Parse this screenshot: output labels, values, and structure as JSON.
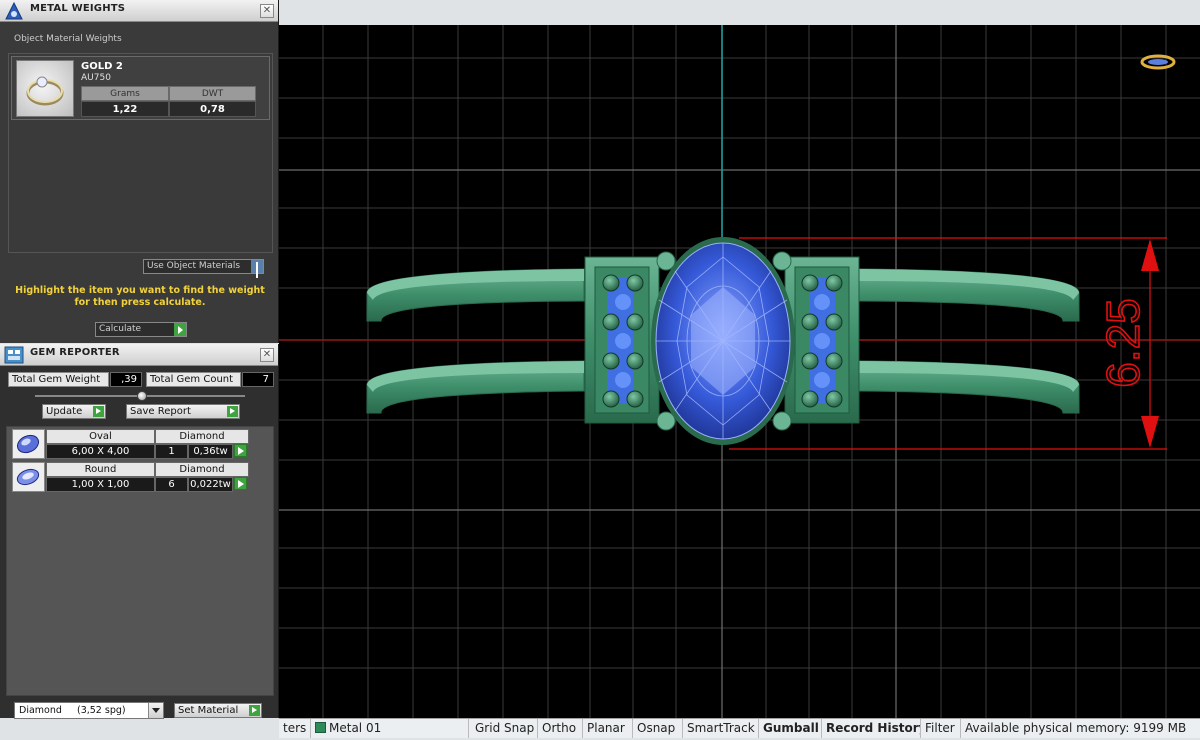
{
  "metal_weights": {
    "title": "METAL WEIGHTS",
    "subtitle": "Object Material Weights",
    "item": {
      "name": "GOLD 2",
      "alloy": "AU750",
      "col_grams": "Grams",
      "col_dwt": "DWT",
      "grams": "1,22",
      "dwt": "0,78"
    },
    "use_materials": "Use Object Materials",
    "hint": "Highlight the item you want to find the weight for then press calculate.",
    "calculate": "Calculate"
  },
  "gem_reporter": {
    "title": "GEM REPORTER",
    "total_weight_label": "Total Gem Weight",
    "total_weight_value": ",39",
    "total_count_label": "Total Gem Count",
    "total_count_value": "7",
    "update": "Update",
    "save_report": "Save Report",
    "gems": [
      {
        "shape": "Oval",
        "material": "Diamond",
        "size": "6,00 X 4,00",
        "qty": "1",
        "weight": "0,36tw"
      },
      {
        "shape": "Round",
        "material": "Diamond",
        "size": "1,00 X 1,00",
        "qty": "6",
        "weight": "0,022tw"
      }
    ],
    "material_select": "Diamond     (3,52 spg)",
    "set_material": "Set Material"
  },
  "viewport": {
    "dimension_label": "6.25"
  },
  "statusbar": {
    "filters_partial": "ters",
    "layer": "Metal 01",
    "grid_snap": "Grid Snap",
    "ortho": "Ortho",
    "planar": "Planar",
    "osnap": "Osnap",
    "smarttrack": "SmartTrack",
    "gumball": "Gumball",
    "record_history": "Record History",
    "filter": "Filter",
    "memory": "Available physical memory: 9199 MB"
  },
  "colors": {
    "metal": "#3e8e6a",
    "gem": "#2b4fc9",
    "dimension": "#e01010",
    "hint": "#f2d23a"
  }
}
